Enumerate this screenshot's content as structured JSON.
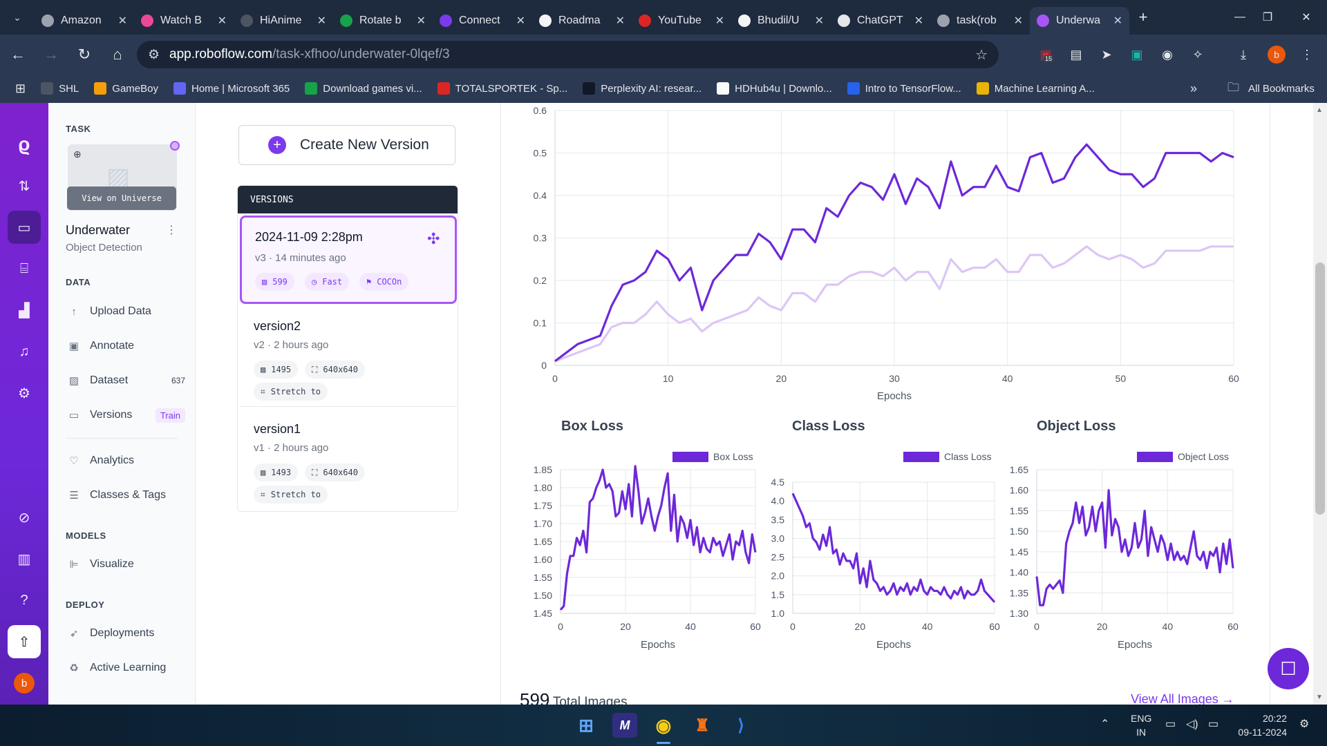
{
  "browser": {
    "tabs": [
      {
        "label": "Amazon",
        "icon": "globe-icon",
        "color": "#9ca3af"
      },
      {
        "label": "Watch B",
        "icon": "play-icon",
        "color": "#ec4899"
      },
      {
        "label": "HiAnime",
        "icon": "hianime-icon",
        "color": "#4b5563"
      },
      {
        "label": "Rotate b",
        "icon": "rotate-icon",
        "color": "#16a34a"
      },
      {
        "label": "Connect",
        "icon": "connect-icon",
        "color": "#7c3aed"
      },
      {
        "label": "Roadma",
        "icon": "rocket-icon",
        "color": "#f3f4f6"
      },
      {
        "label": "YouTube",
        "icon": "youtube-icon",
        "color": "#dc2626"
      },
      {
        "label": "Bhudil/U",
        "icon": "github-icon",
        "color": "#f3f4f6"
      },
      {
        "label": "ChatGPT",
        "icon": "chatgpt-icon",
        "color": "#e5e7eb"
      },
      {
        "label": "task(rob",
        "icon": "infinity-icon",
        "color": "#9ca3af"
      },
      {
        "label": "Underwa",
        "icon": "roboflow-icon",
        "color": "#a855f7",
        "active": true
      }
    ],
    "url_host": "app.roboflow.com",
    "url_path": "/task-xfhoo/underwater-0lqef/3",
    "extension_badge": "15",
    "profile_initial": "b",
    "bookmarks": [
      {
        "label": "SHL",
        "icon": "shl-icon",
        "color": "#4b5563"
      },
      {
        "label": "GameBoy",
        "icon": "gameboy-icon",
        "color": "#f59e0b"
      },
      {
        "label": "Home | Microsoft 365",
        "icon": "m365-icon",
        "color": "#6366f1"
      },
      {
        "label": "Download games vi...",
        "icon": "download-icon",
        "color": "#16a34a"
      },
      {
        "label": "TOTALSPORTEK - Sp...",
        "icon": "ts-icon",
        "color": "#dc2626"
      },
      {
        "label": "Perplexity AI: resear...",
        "icon": "perplexity-icon",
        "color": "#111827"
      },
      {
        "label": "HDHub4u | Downlo...",
        "icon": "hdhub-icon",
        "color": "#f9fafb"
      },
      {
        "label": "Intro to TensorFlow...",
        "icon": "tf-icon",
        "color": "#2563eb"
      },
      {
        "label": "Machine Learning A...",
        "icon": "drive-icon",
        "color": "#eab308"
      }
    ],
    "all_bookmarks": "All Bookmarks"
  },
  "sidebar": {
    "task_heading": "TASK",
    "universe_button": "View on Universe",
    "project_name": "Underwater",
    "project_type": "Object Detection",
    "data_heading": "DATA",
    "data_items": [
      {
        "label": "Upload Data",
        "icon": "upload-arrow-icon"
      },
      {
        "label": "Annotate",
        "icon": "annotate-icon"
      },
      {
        "label": "Dataset",
        "icon": "dataset-icon",
        "badge": "637"
      },
      {
        "label": "Versions",
        "icon": "versions-icon",
        "badge": "Train"
      }
    ],
    "analytics_items": [
      {
        "label": "Analytics",
        "icon": "analytics-icon"
      },
      {
        "label": "Classes & Tags",
        "icon": "classes-icon"
      }
    ],
    "models_heading": "MODELS",
    "models_items": [
      {
        "label": "Visualize",
        "icon": "visualize-icon"
      }
    ],
    "deploy_heading": "DEPLOY",
    "deploy_items": [
      {
        "label": "Deployments",
        "icon": "rocket-icon"
      },
      {
        "label": "Active Learning",
        "icon": "recycle-icon"
      }
    ],
    "avatar_initial": "b"
  },
  "versions": {
    "create_button": "Create New Version",
    "heading": "VERSIONS",
    "items": [
      {
        "title": "2024-11-09 2:28pm",
        "subtitle": "v3 · 14 minutes ago",
        "chips": [
          "599",
          "Fast",
          "COCOn"
        ]
      },
      {
        "title": "version2",
        "subtitle": "v2 · 2 hours ago",
        "chips": [
          "1495",
          "640x640",
          "Stretch to"
        ]
      },
      {
        "title": "version1",
        "subtitle": "v1 · 2 hours ago",
        "chips": [
          "1493",
          "640x640",
          "Stretch to"
        ]
      }
    ]
  },
  "footer": {
    "count": "599",
    "count_label": "Total Images",
    "view_all": "View All Images"
  },
  "taskbar": {
    "lang_top": "ENG",
    "lang_bottom": "IN",
    "time": "20:22",
    "date": "09-11-2024"
  },
  "colors": {
    "accent": "#6d28d9",
    "accent_light": "#dcc6f5",
    "rail": "#7e22ce"
  },
  "chart_data": [
    {
      "type": "line",
      "title": "",
      "xlabel": "Epochs",
      "ylabel": "",
      "xlim": [
        0,
        60
      ],
      "ylim": [
        0,
        0.6
      ],
      "xticks": [
        0,
        10,
        20,
        30,
        40,
        50,
        60
      ],
      "yticks": [
        0,
        0.1,
        0.2,
        0.3,
        0.4,
        0.5,
        0.6
      ],
      "x": [
        0,
        1,
        2,
        3,
        4,
        5,
        6,
        7,
        8,
        9,
        10,
        11,
        12,
        13,
        14,
        15,
        16,
        17,
        18,
        19,
        20,
        21,
        22,
        23,
        24,
        25,
        26,
        27,
        28,
        29,
        30,
        31,
        32,
        33,
        34,
        35,
        36,
        37,
        38,
        39,
        40,
        41,
        42,
        43,
        44,
        45,
        46,
        47,
        48,
        49,
        50,
        51,
        52,
        53,
        54,
        55,
        56,
        57,
        58,
        59,
        60
      ],
      "series": [
        {
          "color": "#6d28d9",
          "values": [
            0.01,
            0.03,
            0.05,
            0.06,
            0.07,
            0.14,
            0.19,
            0.2,
            0.22,
            0.27,
            0.25,
            0.2,
            0.23,
            0.13,
            0.2,
            0.23,
            0.26,
            0.26,
            0.31,
            0.29,
            0.25,
            0.32,
            0.32,
            0.29,
            0.37,
            0.35,
            0.4,
            0.43,
            0.42,
            0.39,
            0.45,
            0.38,
            0.44,
            0.42,
            0.37,
            0.48,
            0.4,
            0.42,
            0.42,
            0.47,
            0.42,
            0.41,
            0.49,
            0.5,
            0.43,
            0.44,
            0.49,
            0.52,
            0.49,
            0.46,
            0.45,
            0.45,
            0.42,
            0.44,
            0.5,
            0.5,
            0.5,
            0.5,
            0.48,
            0.5,
            0.49
          ]
        },
        {
          "color": "#dcc6f5",
          "values": [
            0.01,
            0.02,
            0.03,
            0.04,
            0.05,
            0.09,
            0.1,
            0.1,
            0.12,
            0.15,
            0.12,
            0.1,
            0.11,
            0.08,
            0.1,
            0.11,
            0.12,
            0.13,
            0.16,
            0.14,
            0.13,
            0.17,
            0.17,
            0.15,
            0.19,
            0.19,
            0.21,
            0.22,
            0.22,
            0.21,
            0.23,
            0.2,
            0.22,
            0.22,
            0.18,
            0.25,
            0.22,
            0.23,
            0.23,
            0.25,
            0.22,
            0.22,
            0.26,
            0.26,
            0.23,
            0.24,
            0.26,
            0.28,
            0.26,
            0.25,
            0.26,
            0.25,
            0.23,
            0.24,
            0.27,
            0.27,
            0.27,
            0.27,
            0.28,
            0.28,
            0.28
          ]
        }
      ]
    },
    {
      "type": "line",
      "title": "Box Loss",
      "xlabel": "Epochs",
      "xlim": [
        0,
        60
      ],
      "ylim": [
        1.45,
        1.85
      ],
      "xticks": [
        0,
        20,
        40,
        60
      ],
      "yticks": [
        1.45,
        1.5,
        1.55,
        1.6,
        1.65,
        1.7,
        1.75,
        1.8,
        1.85
      ],
      "legend": "Box Loss",
      "series": [
        {
          "name": "Box Loss",
          "color": "#6d28d9",
          "values": [
            1.46,
            1.47,
            1.56,
            1.61,
            1.61,
            1.66,
            1.64,
            1.68,
            1.62,
            1.76,
            1.77,
            1.8,
            1.82,
            1.85,
            1.8,
            1.81,
            1.79,
            1.72,
            1.73,
            1.79,
            1.74,
            1.81,
            1.72,
            1.86,
            1.79,
            1.7,
            1.73,
            1.77,
            1.72,
            1.68,
            1.72,
            1.75,
            1.8,
            1.84,
            1.68,
            1.78,
            1.65,
            1.72,
            1.7,
            1.66,
            1.71,
            1.64,
            1.69,
            1.62,
            1.66,
            1.63,
            1.62,
            1.66,
            1.64,
            1.65,
            1.61,
            1.64,
            1.67,
            1.6,
            1.65,
            1.64,
            1.68,
            1.62,
            1.59,
            1.67,
            1.62
          ]
        }
      ]
    },
    {
      "type": "line",
      "title": "Class Loss",
      "xlabel": "Epochs",
      "xlim": [
        0,
        60
      ],
      "ylim": [
        1.0,
        4.5
      ],
      "xticks": [
        0,
        20,
        40,
        60
      ],
      "yticks": [
        1.0,
        1.5,
        2.0,
        2.5,
        3.0,
        3.5,
        4.0,
        4.5
      ],
      "legend": "Class Loss",
      "series": [
        {
          "name": "Class Loss",
          "color": "#6d28d9",
          "values": [
            4.2,
            4.0,
            3.8,
            3.6,
            3.3,
            3.4,
            3.0,
            2.9,
            2.7,
            3.1,
            2.8,
            3.3,
            2.6,
            2.7,
            2.3,
            2.6,
            2.4,
            2.4,
            2.2,
            2.6,
            1.8,
            2.2,
            1.7,
            2.4,
            1.9,
            1.8,
            1.6,
            1.7,
            1.5,
            1.6,
            1.8,
            1.5,
            1.7,
            1.6,
            1.8,
            1.5,
            1.7,
            1.6,
            1.9,
            1.6,
            1.5,
            1.7,
            1.6,
            1.6,
            1.5,
            1.7,
            1.5,
            1.4,
            1.6,
            1.5,
            1.7,
            1.4,
            1.6,
            1.5,
            1.5,
            1.6,
            1.9,
            1.6,
            1.5,
            1.4,
            1.3
          ]
        }
      ]
    },
    {
      "type": "line",
      "title": "Object Loss",
      "xlabel": "Epochs",
      "xlim": [
        0,
        60
      ],
      "ylim": [
        1.3,
        1.65
      ],
      "xticks": [
        0,
        20,
        40,
        60
      ],
      "yticks": [
        1.3,
        1.35,
        1.4,
        1.45,
        1.5,
        1.55,
        1.6,
        1.65
      ],
      "legend": "Object Loss",
      "series": [
        {
          "name": "Object Loss",
          "color": "#6d28d9",
          "values": [
            1.39,
            1.32,
            1.32,
            1.36,
            1.37,
            1.36,
            1.37,
            1.38,
            1.35,
            1.47,
            1.5,
            1.52,
            1.57,
            1.52,
            1.56,
            1.49,
            1.51,
            1.56,
            1.5,
            1.55,
            1.57,
            1.46,
            1.6,
            1.49,
            1.53,
            1.51,
            1.45,
            1.48,
            1.44,
            1.46,
            1.52,
            1.46,
            1.48,
            1.55,
            1.44,
            1.51,
            1.48,
            1.45,
            1.49,
            1.47,
            1.43,
            1.47,
            1.43,
            1.45,
            1.43,
            1.44,
            1.42,
            1.46,
            1.5,
            1.44,
            1.43,
            1.45,
            1.41,
            1.45,
            1.44,
            1.46,
            1.4,
            1.47,
            1.42,
            1.48,
            1.41
          ]
        }
      ]
    }
  ]
}
